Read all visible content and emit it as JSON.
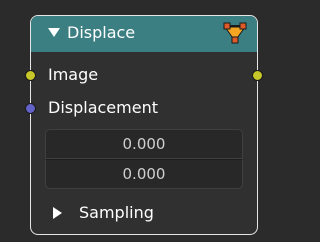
{
  "node": {
    "title": "Displace",
    "icon": "node-group-icon",
    "header_color": "#3c7f83"
  },
  "sockets": {
    "input_image_label": "Image",
    "input_image_color": "#c7c729",
    "input_displacement_label": "Displacement",
    "input_displacement_color": "#6363c7",
    "output_image_color": "#c7c729"
  },
  "fields": {
    "x_value": "0.000",
    "y_value": "0.000"
  },
  "panel": {
    "sampling_label": "Sampling"
  }
}
